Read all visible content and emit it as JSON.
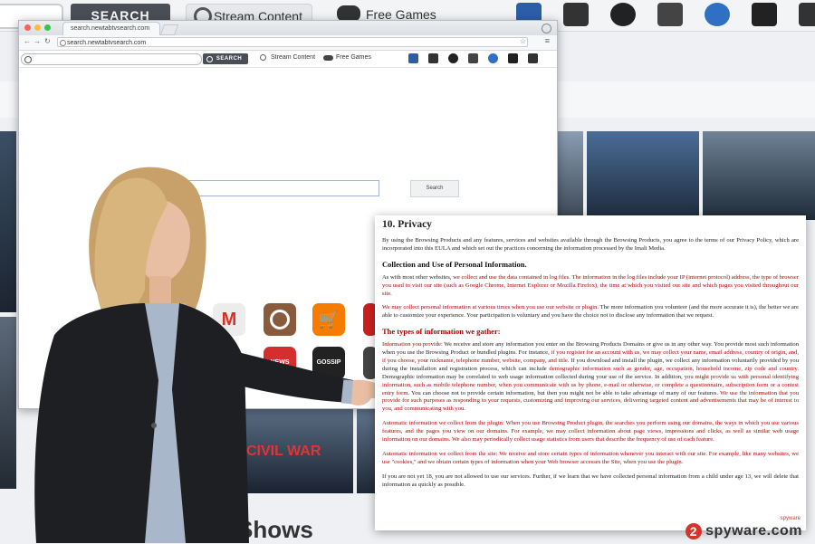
{
  "background_toolbar": {
    "search_button": "SEARCH",
    "stream_label": "Stream Content",
    "games_label": "Free Games",
    "icons": [
      "film-icon",
      "tv-icon",
      "basketball-icon",
      "browser-window-icon",
      "people-icon",
      "mail-icon",
      "cart-icon"
    ]
  },
  "background_page": {
    "shows_text": "Shows",
    "movie_tile_text": "CIVIL WAR"
  },
  "browser": {
    "tab_title": "search.newtabtvsearch.com",
    "url": "search.newtabtvsearch.com",
    "toolbar": {
      "search_button": "SEARCH",
      "stream_label": "Stream Content",
      "games_label": "Free Games"
    },
    "main_search_button": "Search",
    "apps": [
      {
        "name": "gmail",
        "label": "M",
        "color": "#e9e9e9",
        "text_color": "#d93025"
      },
      {
        "name": "instagram",
        "label": "",
        "color": "#8a5a3c"
      },
      {
        "name": "shop",
        "label": "",
        "color": "#f57c00"
      },
      {
        "name": "youtube",
        "label": "",
        "color": "#cc1f1f"
      },
      {
        "name": "news",
        "label": "NEWS",
        "color": "#d32f2f"
      },
      {
        "name": "gossip",
        "label": "GOSSIP",
        "color": "#222222"
      }
    ]
  },
  "document": {
    "heading": "10. Privacy",
    "intro": "By using the Browsing Products and any features, services and websites available through the Browsing Products, you agree to the terms of our Privacy Policy, which are incorporated into this EULA and which set out the practices concerning the information processed by the Imali Media.",
    "section1_title": "Collection and Use of Personal Information.",
    "p1_a": "As with most other websites, ",
    "p1_b": "we collect and use the data contained in log files. The information in the log files include your IP (internet protocol) address, the type of browser you used to visit our site (such as Google Chrome, Internet Explorer or Mozilla Firefox), the time at which you visited our site and which pages you visited throughout our site.",
    "p2_a": "We may collect personal information at various times when you use our website or plugin.",
    "p2_b": " The more information you volunteer (and the more accurate it is), the better we are able to customize your experience. Your participation is voluntary and you have the choice not to disclose any information that we request.",
    "section2_title": "The types of information we gather:",
    "p3_a": "Information you provide",
    "p3_b": ": We receive and store any information you enter on the Browsing Products Domains or give us in any other way. You provide most such information when you use the Browsing Product or bundled plugins. For instance, ",
    "p3_c": "if you register for an account with us, we may collect your name, email address, country of origin, and, if you choose, your nickname, telephone number, website, company, and title.",
    "p3_d": " If you download and install the plugin, we collect any information voluntarily provided by you during the installation and registration process, which can include ",
    "p3_e": "demographic information such as gender, age, occupation, household income, zip code and country.",
    "p3_f": " Demographic information may be correlated to web usage information collected during your use of the service. In addition, ",
    "p3_g": "you might provide us with personal identifying information, such as mobile telephone number, when you communicate with us by phone, e-mail or otherwise, or complete a questionnaire, subscription form or a contest entry form.",
    "p3_h": " You can choose not to provide certain information, but then you might not be able to take advantage of many of our features. ",
    "p3_i": "We use the information that you provide for such purposes as responding to your requests, customizing and improving our services, delivering targeted content and advertisements that may be of interest to you, and communicating with you.",
    "p4": "Automatic information we collect from the plugin: When you use Browsing Product plugin, the searches you perform using our domains, the ways in which you use various features, and the pages you view on our domains. For example, we may collect information about page views, impressions and clicks, as well as similar web usage information on our domains. We also may periodically collect usage statistics from users that describe the frequency of use of each feature.",
    "p5": "Automatic information we collect from the site: We receive and store certain types of information whenever you interact with our site. For example, like many websites, we use \"cookies,\" and we obtain certain types of information when your Web browser accesses the Site, when you use the plugin.",
    "p6": "If you are not yet 18, you are not allowed to use our services. Further, if we learn that we have collected personal information from a child under age 13, we will delete that information as quickly as possible."
  },
  "watermark": {
    "small": "spyware",
    "logo_number": "2",
    "logo_text": "spyware.com"
  }
}
